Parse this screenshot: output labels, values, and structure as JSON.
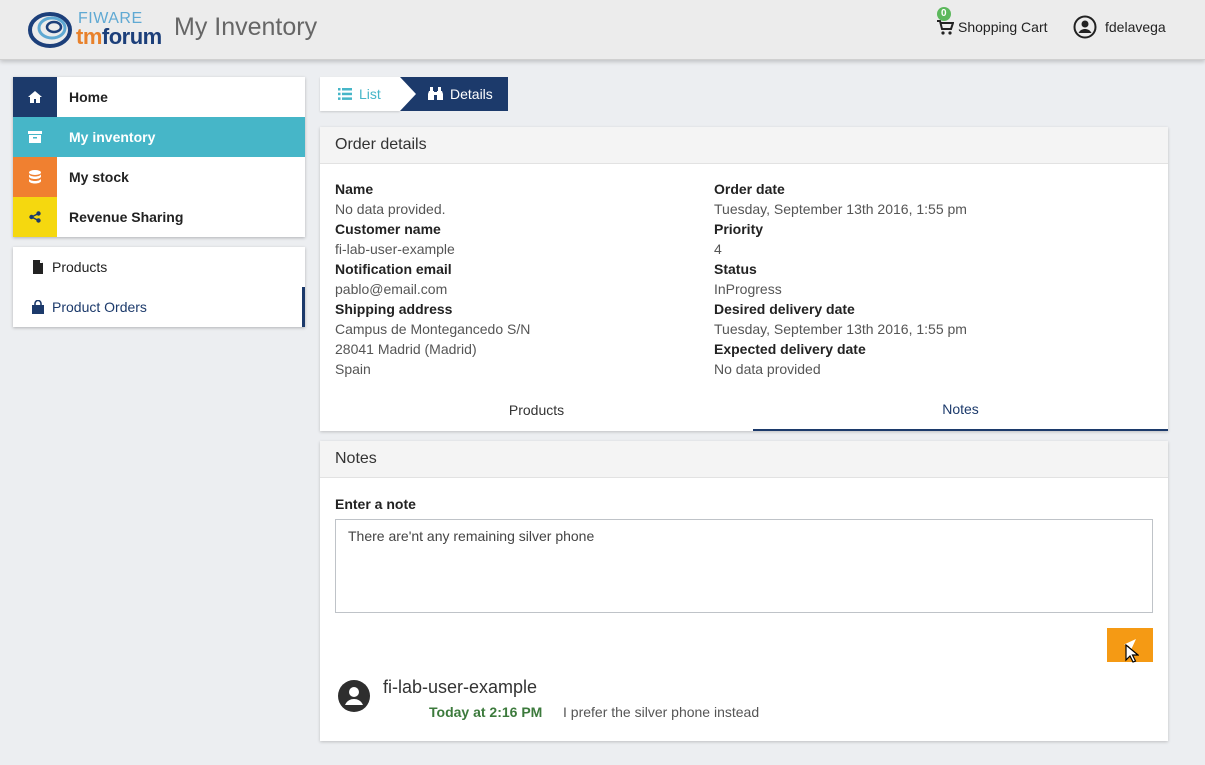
{
  "header": {
    "logo_top": "FIWARE",
    "logo_tm": "tm",
    "logo_forum": "forum",
    "title": "My Inventory",
    "cart_count": "0",
    "cart_label": "Shopping Cart",
    "username": "fdelavega"
  },
  "sidebar": {
    "items": [
      {
        "label": "Home",
        "icon": "home-icon"
      },
      {
        "label": "My inventory",
        "icon": "archive-icon"
      },
      {
        "label": "My stock",
        "icon": "database-icon"
      },
      {
        "label": "Revenue Sharing",
        "icon": "share-icon"
      }
    ],
    "subitems": [
      {
        "label": "Products",
        "icon": "file-icon"
      },
      {
        "label": "Product Orders",
        "icon": "shopping-bag-icon"
      }
    ]
  },
  "breadcrumb": {
    "list_label": "List",
    "details_label": "Details"
  },
  "order": {
    "title": "Order details",
    "name_label": "Name",
    "name_value": "No data provided.",
    "customer_label": "Customer name",
    "customer_value": "fi-lab-user-example",
    "email_label": "Notification email",
    "email_value": "pablo@email.com",
    "shipping_label": "Shipping address",
    "shipping_line1": "Campus de Montegancedo S/N",
    "shipping_line2": "28041 Madrid (Madrid)",
    "shipping_line3": "Spain",
    "order_date_label": "Order date",
    "order_date_value": "Tuesday, September 13th 2016, 1:55 pm",
    "priority_label": "Priority",
    "priority_value": "4",
    "status_label": "Status",
    "status_value": "InProgress",
    "desired_label": "Desired delivery date",
    "desired_value": "Tuesday, September 13th 2016, 1:55 pm",
    "expected_label": "Expected delivery date",
    "expected_value": "No data provided",
    "tabs": [
      {
        "label": "Products"
      },
      {
        "label": "Notes"
      }
    ]
  },
  "notes": {
    "title": "Notes",
    "input_label": "Enter a note",
    "input_value": "There are'nt any remaining silver phone",
    "entry": {
      "author": "fi-lab-user-example",
      "time": "Today at 2:16 PM",
      "text": "I prefer the silver phone instead"
    }
  },
  "colors": {
    "navy": "#1c3a6b",
    "teal": "#46b6c8",
    "orange": "#f08030",
    "yellow": "#f5d80f",
    "send": "#f59a14"
  }
}
